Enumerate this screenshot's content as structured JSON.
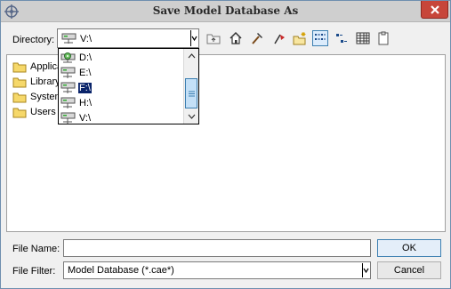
{
  "window": {
    "title": "Save Model Database As"
  },
  "directory": {
    "label": "Directory:",
    "value": "V:\\"
  },
  "toolbar": {
    "buttons": [
      "parent-folder-icon",
      "home-icon",
      "working-dir-hammer-icon",
      "bookmark-flag-icon",
      "new-folder-icon",
      "list-view-icon",
      "details-view-icon",
      "table-view-icon",
      "clipboard-icon"
    ],
    "active_view": "list-view-icon"
  },
  "files": [
    "Applica",
    "Library",
    "System",
    "Users"
  ],
  "drive_dropdown": {
    "items": [
      "D:\\",
      "E:\\",
      "F:\\",
      "H:\\",
      "V:\\"
    ],
    "selected": "F:\\"
  },
  "file_name": {
    "label": "File Name:",
    "value": ""
  },
  "file_filter": {
    "label": "File Filter:",
    "value": "Model Database (*.cae*)"
  },
  "buttons": {
    "ok": "OK",
    "cancel": "Cancel"
  },
  "colors": {
    "selection": "#0a246a",
    "close_button": "#c7463a",
    "accent": "#3c7fb1"
  }
}
